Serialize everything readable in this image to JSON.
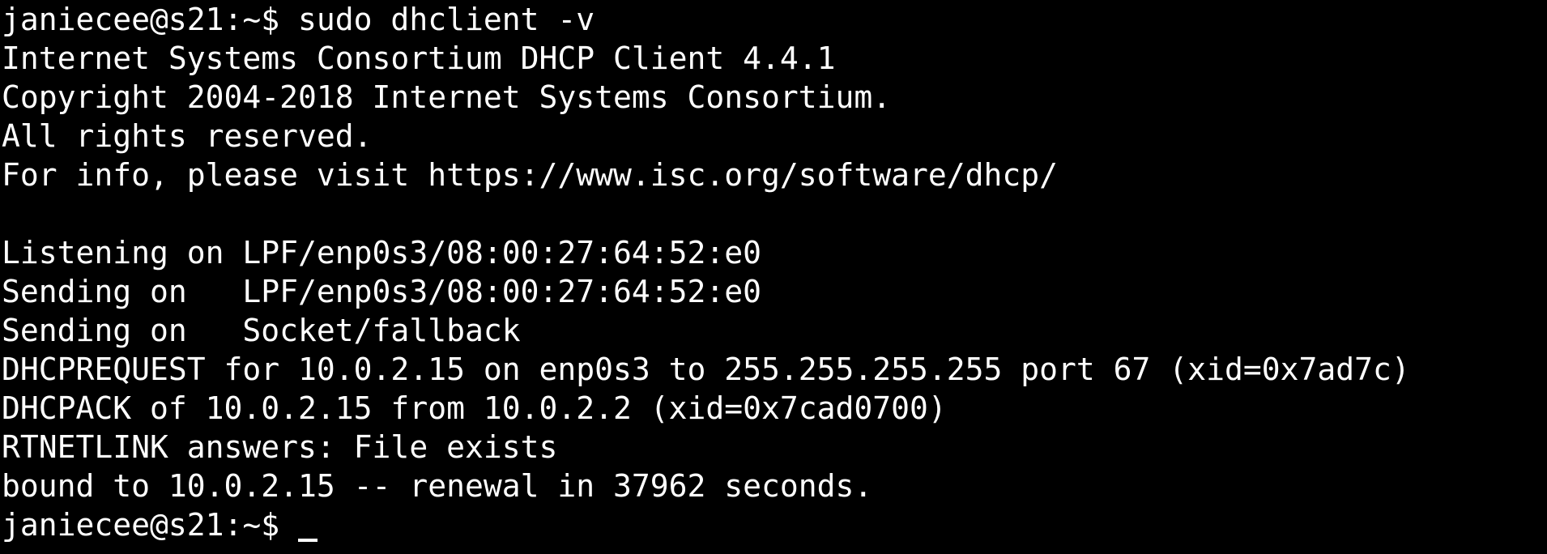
{
  "colors": {
    "background": "#000000",
    "foreground": "#ffffff"
  },
  "terminal": {
    "lines": [
      "janiecee@s21:~$ sudo dhclient -v",
      "Internet Systems Consortium DHCP Client 4.4.1",
      "Copyright 2004-2018 Internet Systems Consortium.",
      "All rights reserved.",
      "For info, please visit https://www.isc.org/software/dhcp/",
      "",
      "Listening on LPF/enp0s3/08:00:27:64:52:e0",
      "Sending on   LPF/enp0s3/08:00:27:64:52:e0",
      "Sending on   Socket/fallback",
      "DHCPREQUEST for 10.0.2.15 on enp0s3 to 255.255.255.255 port 67 (xid=0x7ad7c)",
      "DHCPACK of 10.0.2.15 from 10.0.2.2 (xid=0x7cad0700)",
      "RTNETLINK answers: File exists",
      "bound to 10.0.2.15 -- renewal in 37962 seconds."
    ],
    "prompt": "janiecee@s21:~$ "
  }
}
